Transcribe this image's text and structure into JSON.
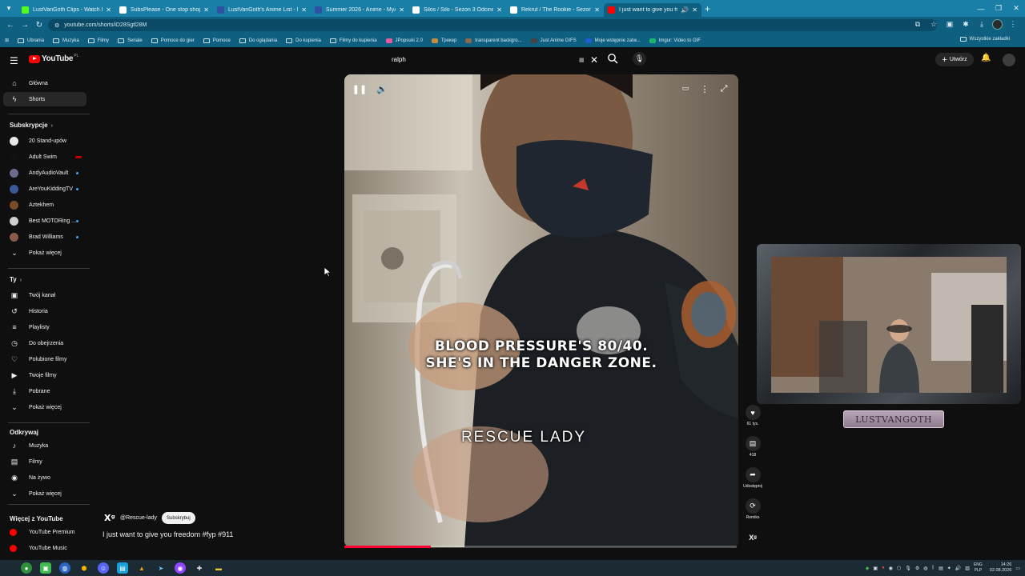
{
  "browser": {
    "tabs": [
      {
        "title": "LustVanGoth Clips - Watch Live",
        "color": "#53fc18",
        "active": false
      },
      {
        "title": "SubsPlease - One stop shop fo",
        "color": "#ffffff",
        "active": false
      },
      {
        "title": "LustVanGoth's Anime List - My",
        "color": "#2e51a2",
        "active": false
      },
      {
        "title": "Summer 2026 - Anime - MyAni",
        "color": "#2e51a2",
        "active": false
      },
      {
        "title": "Silos / Silo - Sezon 3 Odcinek 2",
        "color": "#ffffff",
        "active": false
      },
      {
        "title": "Rekrut / The Rookie - Sezon 2",
        "color": "#ffffff",
        "active": false
      },
      {
        "title": "I just want to give you freed",
        "color": "#ff0000",
        "active": true
      }
    ],
    "url": "youtube.com/shorts/iD28Sgtl28M",
    "bookmarks": [
      {
        "label": "Ubrania",
        "color": ""
      },
      {
        "label": "Muzyka",
        "color": ""
      },
      {
        "label": "Filmy",
        "color": ""
      },
      {
        "label": "Seriale",
        "color": ""
      },
      {
        "label": "Pomoce do gier",
        "color": ""
      },
      {
        "label": "Pomoce",
        "color": ""
      },
      {
        "label": "Do oglądania",
        "color": ""
      },
      {
        "label": "Do kupienia",
        "color": ""
      },
      {
        "label": "Filmy do kupienia",
        "color": ""
      },
      {
        "label": "JPopsuki 2.0",
        "color": "#e55a9a"
      },
      {
        "label": "Трекер",
        "color": "#c98a3a"
      },
      {
        "label": "transparent backgro...",
        "color": "#8a6a4a"
      },
      {
        "label": "Just Anime GIFS",
        "color": "#444"
      },
      {
        "label": "Moje wstępnie zatw...",
        "color": "#1f5bd1"
      },
      {
        "label": "Imgur: Video to GIF",
        "color": "#1bb76e"
      }
    ],
    "all_bookmarks": "Wszystkie zakładki"
  },
  "header": {
    "logo": "YouTube",
    "country": "PL",
    "search_value": "ralph",
    "create_label": "Utwórz"
  },
  "sidebar": {
    "main": [
      {
        "label": "Główna",
        "icon": "home-icon",
        "glyph": "⌂"
      },
      {
        "label": "Shorts",
        "icon": "shorts-icon",
        "glyph": "ϟ"
      }
    ],
    "subs_heading": "Subskrypcje",
    "subs": [
      {
        "label": "20 Stand-upów",
        "color": "#e8e8e8",
        "mark": ""
      },
      {
        "label": "Adult Swim",
        "color": "#111111",
        "mark": "live"
      },
      {
        "label": "AndyAudioVault",
        "color": "#6b6b8c",
        "mark": "dot"
      },
      {
        "label": "AreYouKiddingTV",
        "color": "#3a5a9a",
        "mark": "dot"
      },
      {
        "label": "Aztekhem",
        "color": "#7a4a2a",
        "mark": ""
      },
      {
        "label": "Best MOTORing ...",
        "color": "#cfcfcf",
        "mark": "dot"
      },
      {
        "label": "Brad Williams",
        "color": "#8a5a4a",
        "mark": "dot"
      }
    ],
    "show_more": "Pokaż więcej",
    "you_heading": "Ty",
    "you": [
      {
        "label": "Twój kanał",
        "glyph": "▣",
        "icon": "your-channel-icon"
      },
      {
        "label": "Historia",
        "glyph": "↺",
        "icon": "history-icon"
      },
      {
        "label": "Playlisty",
        "glyph": "≡",
        "icon": "playlists-icon"
      },
      {
        "label": "Do obejrzenia",
        "glyph": "◷",
        "icon": "watch-later-icon"
      },
      {
        "label": "Polubione filmy",
        "glyph": "♡",
        "icon": "liked-videos-icon"
      },
      {
        "label": "Twoje filmy",
        "glyph": "▶",
        "icon": "your-videos-icon"
      },
      {
        "label": "Pobrane",
        "glyph": "⤓",
        "icon": "downloads-icon"
      }
    ],
    "explore_heading": "Odkrywaj",
    "explore": [
      {
        "label": "Muzyka",
        "glyph": "♪",
        "icon": "music-icon"
      },
      {
        "label": "Filmy",
        "glyph": "▤",
        "icon": "movies-icon"
      },
      {
        "label": "Na żywo",
        "glyph": "◉",
        "icon": "live-icon"
      }
    ],
    "more_heading": "Więcej z YouTube",
    "more": [
      {
        "label": "YouTube Premium",
        "color": "#ff0000"
      },
      {
        "label": "YouTube Music",
        "color": "#ff0000"
      }
    ]
  },
  "short": {
    "caption_line1": "BLOOD PRESSURE'S 80/40.",
    "caption_line2": "SHE'S IN THE DANGER ZONE.",
    "watermark": "RESCUE LADY",
    "channel_handle": "@Rescue-lady",
    "channel_avatar": "Xᵍ",
    "subscribe_label": "Subskrybuj",
    "title": "I just want to give you freedom #fyp #911",
    "progress": 0.22,
    "likes": "61 tys.",
    "comments": "418",
    "share_label": "Udostępnij",
    "remix_label": "Remiks"
  },
  "overlay": {
    "streamer_name": "LUSTVANGOTH"
  },
  "taskbar": {
    "lang_top": "ENG",
    "lang_bottom": "PLP",
    "time": "14:26",
    "date": "02.08.2026"
  }
}
